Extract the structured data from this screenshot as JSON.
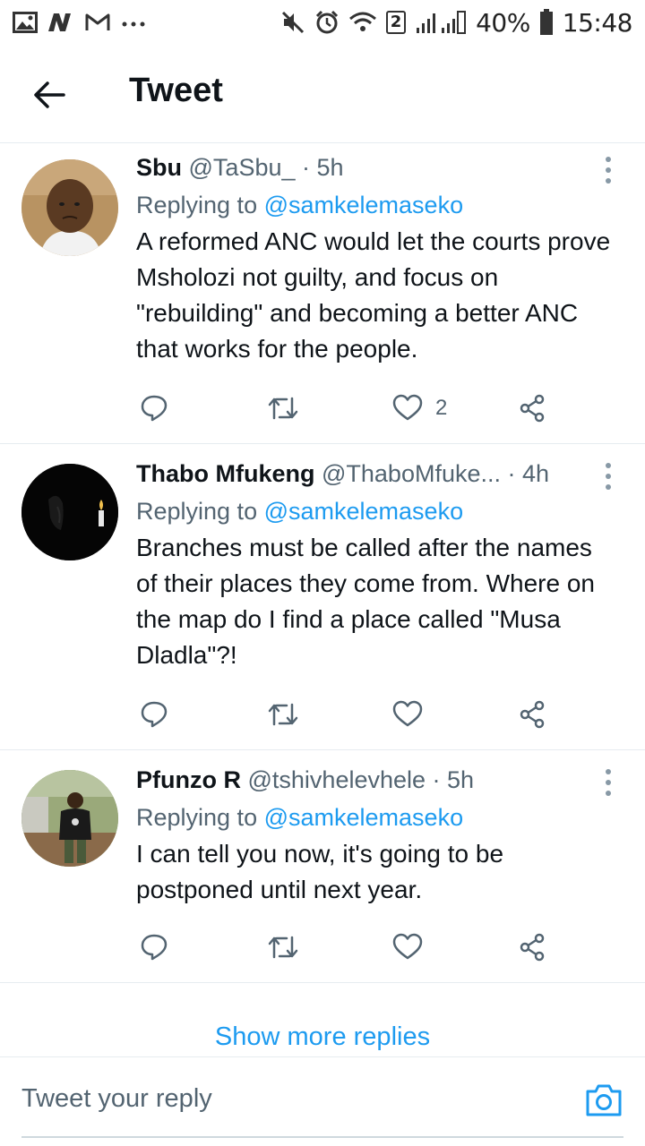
{
  "status_bar": {
    "battery_percent": "40%",
    "time": "15:48",
    "sim_badge": "2",
    "icons_left": [
      "gallery-icon",
      "news-icon",
      "gmail-icon",
      "more-dots-icon"
    ],
    "icons_right": [
      "mute-icon",
      "alarm-icon",
      "wifi-icon",
      "signal-icon",
      "battery-icon"
    ]
  },
  "header": {
    "back_icon": "arrow-left-icon",
    "title": "Tweet"
  },
  "tweets": [
    {
      "name": "Sbu",
      "handle": "@TaSbu_",
      "time": "· 5h",
      "replying_prefix": "Replying to ",
      "replying_to": "@samkelemaseko",
      "text": "A reformed ANC would let the courts prove Msholozi not guilty, and focus on \"rebuilding\" and becoming a better ANC that works for the people.",
      "likes": "2"
    },
    {
      "name": "Thabo Mfukeng",
      "handle": "@ThaboMfuke...",
      "time": "· 4h",
      "replying_prefix": "Replying to ",
      "replying_to": "@samkelemaseko",
      "text": "Branches must be called after the names of their places they come from. Where on the map do I find a place called \"Musa Dladla\"?!",
      "likes": ""
    },
    {
      "name": "Pfunzo R",
      "handle": "@tshivhelevhele",
      "time": "· 5h",
      "replying_prefix": "Replying to ",
      "replying_to": "@samkelemaseko",
      "text": "I can tell you now, it's going to be postponed until next year.",
      "likes": ""
    }
  ],
  "action_icons": [
    "reply-icon",
    "retweet-icon",
    "like-icon",
    "share-icon"
  ],
  "show_more": "Show more replies",
  "reply_bar": {
    "placeholder": "Tweet your reply",
    "camera_icon": "camera-icon"
  },
  "colors": {
    "accent": "#1d9bf0",
    "text": "#0f1419",
    "secondary": "#536471",
    "divider": "#e6ecf0"
  }
}
